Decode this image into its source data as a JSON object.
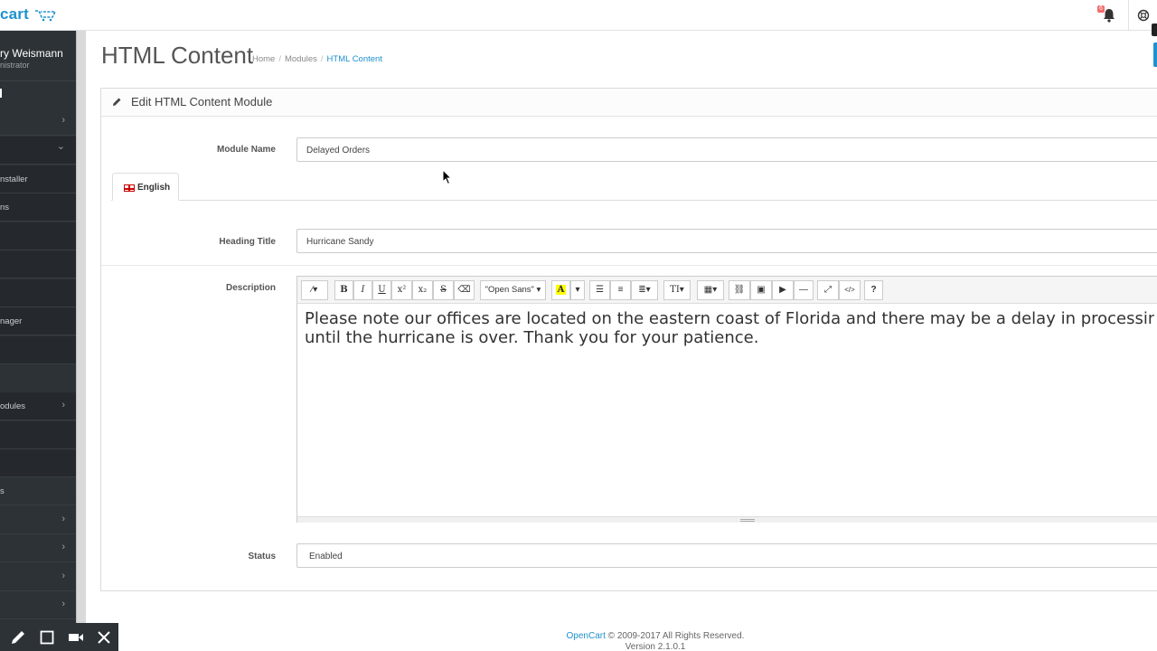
{
  "header": {
    "logo_text": "cart",
    "notification_count": "6"
  },
  "sidebar": {
    "profile": {
      "name": "ry Weismann",
      "role": "nistrator"
    },
    "items": [
      {
        "label": "",
        "chevron": "›"
      },
      {
        "label": "",
        "chevron": "⌄"
      },
      {
        "label": "nstaller",
        "chevron": ""
      },
      {
        "label": "ns",
        "chevron": ""
      },
      {
        "label": "",
        "chevron": ""
      },
      {
        "label": "",
        "chevron": ""
      },
      {
        "label": "",
        "chevron": ""
      },
      {
        "label": "nager",
        "chevron": ""
      },
      {
        "label": "",
        "chevron": ""
      },
      {
        "label": "odules",
        "chevron": "›"
      },
      {
        "label": "",
        "chevron": ""
      },
      {
        "label": "",
        "chevron": ""
      },
      {
        "label": "s",
        "chevron": ""
      },
      {
        "label": "",
        "chevron": "›"
      },
      {
        "label": "",
        "chevron": "›"
      },
      {
        "label": "",
        "chevron": "›"
      },
      {
        "label": "",
        "chevron": "›"
      }
    ]
  },
  "page": {
    "title": "HTML Content",
    "breadcrumb": [
      "Home",
      "Modules",
      "HTML Content"
    ]
  },
  "panel": {
    "heading": "Edit HTML Content Module",
    "module_name_label": "Module Name",
    "module_name_value": "Delayed Orders",
    "tab_label": "English",
    "heading_title_label": "Heading Title",
    "heading_title_value": "Hurricane Sandy",
    "description_label": "Description",
    "font_name": "\"Open Sans\"",
    "description_line1": "Please note our offices are located on the eastern coast of Florida and there may be a delay in processin",
    "description_line2": "until the hurricane is over.  Thank you for your patience.",
    "status_label": "Status",
    "status_value": "Enabled"
  },
  "footer": {
    "brand": "OpenCart",
    "copyright": " © 2009-2017 All Rights Reserved.",
    "version": "Version 2.1.0.1"
  },
  "colors": {
    "accent": "#1e91cf",
    "sidebar": "#2d3237"
  }
}
